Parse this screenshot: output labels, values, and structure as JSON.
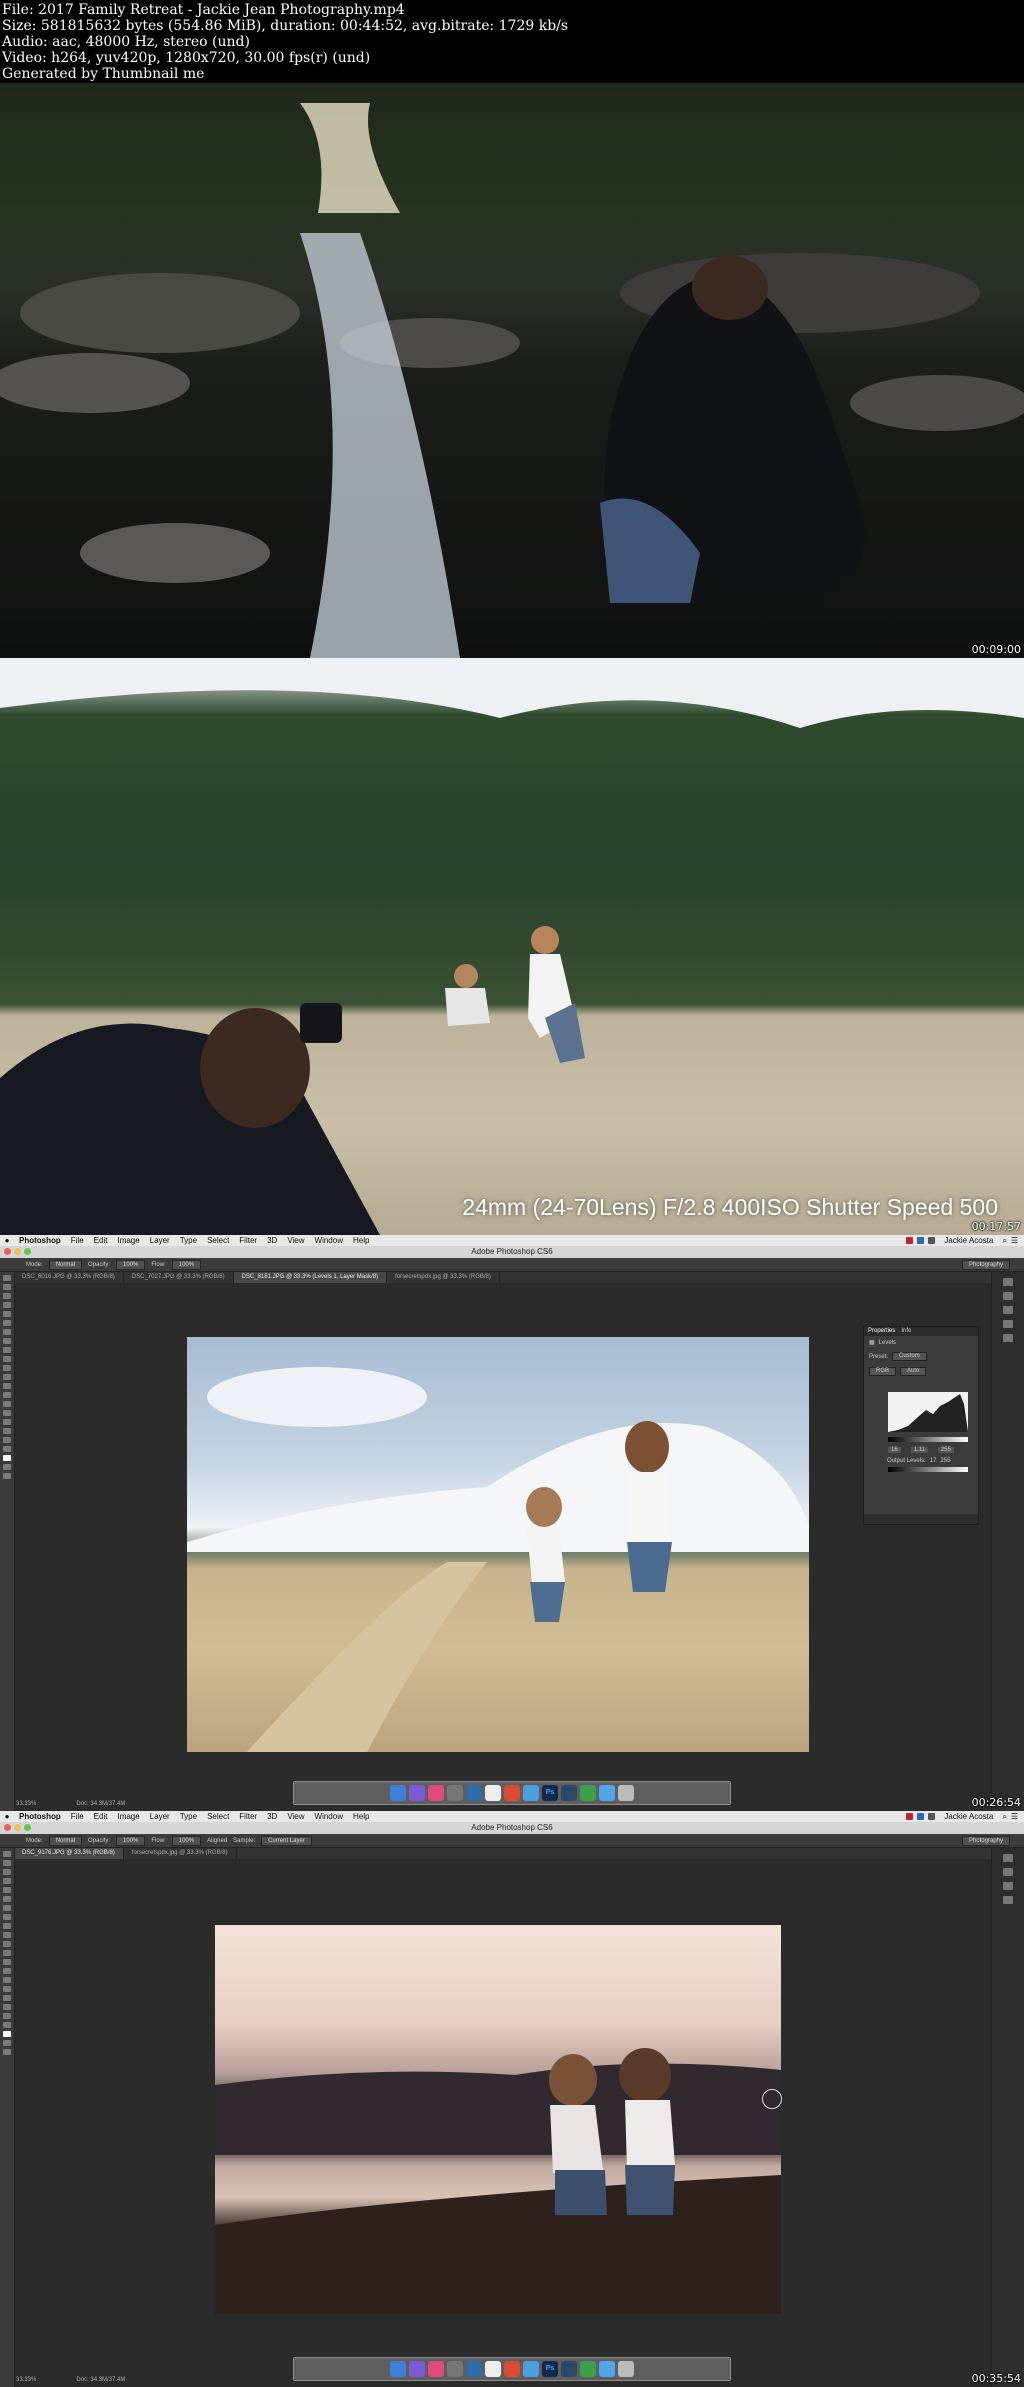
{
  "info": {
    "line1": "File: 2017 Family Retreat - Jackie Jean Photography.mp4",
    "line2": "Size: 581815632 bytes (554.86 MiB), duration: 00:44:52, avg.bitrate: 1729 kb/s",
    "line3": "Audio: aac, 48000 Hz, stereo (und)",
    "line4": "Video: h264, yuv420p, 1280x720, 30.00 fps(r) (und)",
    "line5": "Generated by Thumbnail me"
  },
  "frames": [
    {
      "timestamp": "00:09:00"
    },
    {
      "timestamp": "00:17:57",
      "caption": "24mm (24-70Lens)  F/2.8 400ISO Shutter Speed 500"
    },
    {
      "timestamp": "00:26:54"
    },
    {
      "timestamp": "00:35:54"
    }
  ],
  "photoshop": {
    "app_name": "Photoshop",
    "menu": [
      "File",
      "Edit",
      "Image",
      "Layer",
      "Type",
      "Select",
      "Filter",
      "3D",
      "View",
      "Window",
      "Help"
    ],
    "user": "Jackie Acosta",
    "window_title": "Adobe Photoshop CS6",
    "workspace": "Photography",
    "frame3": {
      "options": {
        "mode_label": "Mode:",
        "mode": "Normal",
        "opacity_label": "Opacity:",
        "opacity": "100%",
        "flow_label": "Flow:",
        "flow": "100%"
      },
      "tabs": [
        "DSC_8016.JPG @ 33.3% (RGB/8)",
        "DSC_7027.JPG @ 33.3% (RGB/8)",
        "DSC_8181.JPG @ 33.3% (Levels 1, Layer Mask/8)",
        "forsecretspdx.jpg @ 33.3% (RGB/8)"
      ],
      "active_tab": 2,
      "status_zoom": "33.33%",
      "status_doc": "Doc: 34.3M/37.4M",
      "panel": {
        "tabs": [
          "Properties",
          "Info"
        ],
        "title": "Levels",
        "preset_label": "Preset:",
        "preset": "Custom",
        "channel": "RGB",
        "auto_label": "Auto",
        "inputs": [
          "16",
          "1.11",
          "255"
        ],
        "output_label": "Output Levels:",
        "outputs": [
          "17",
          "255"
        ]
      }
    },
    "frame4": {
      "options": {
        "mode_label": "Mode:",
        "mode": "Normal",
        "opacity_label": "Opacity:",
        "opacity": "100%",
        "flow_label": "Flow:",
        "flow": "100%",
        "aligned_label": "Aligned",
        "sample_label": "Sample:",
        "sample": "Current Layer"
      },
      "tabs": [
        "DSC_9176.JPG @ 33.3% (RGB/8)",
        "forsecretspdx.jpg @ 33.3% (RGB/8)"
      ],
      "active_tab": 0,
      "status_zoom": "33.33%",
      "status_doc": "Doc: 34.3M/37.4M"
    },
    "dock_icons": [
      "finder-icon",
      "launchpad-icon",
      "itunes-icon",
      "preferences-icon",
      "photoshop-bridge-icon",
      "calendar-icon",
      "chrome-icon",
      "safari-icon",
      "ps-icon",
      "lightroom-icon",
      "camtasia-icon",
      "folder-icon",
      "trash-icon"
    ],
    "dock_ps_label": "Ps"
  },
  "colors": {
    "photoshop_bg": "#2b2b2b",
    "mac_menu_bg": "#e8e8e8"
  }
}
